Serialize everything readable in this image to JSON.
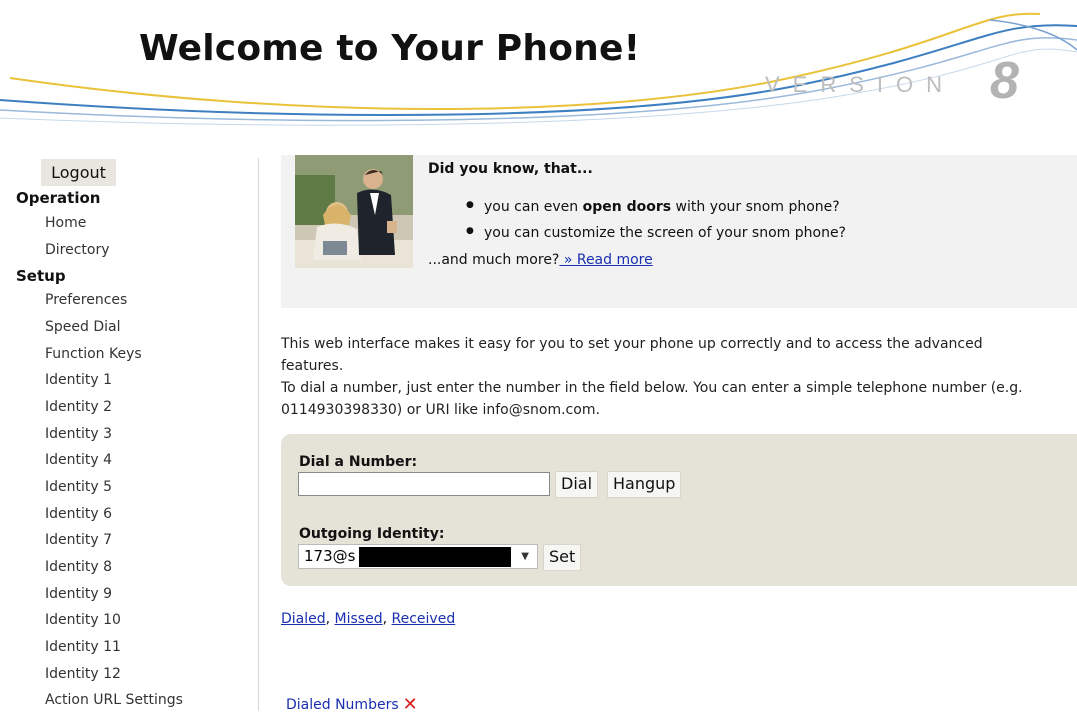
{
  "header": {
    "title": "Welcome to Your Phone!",
    "version_word": "VERSION",
    "version_number": "8"
  },
  "sidebar": {
    "logout_label": "Logout",
    "sections": [
      {
        "label": "Operation",
        "items": [
          "Home",
          "Directory"
        ]
      },
      {
        "label": "Setup",
        "items": [
          "Preferences",
          "Speed Dial",
          "Function Keys",
          "Identity 1",
          "Identity 2",
          "Identity 3",
          "Identity 4",
          "Identity 5",
          "Identity 6",
          "Identity 7",
          "Identity 8",
          "Identity 9",
          "Identity 10",
          "Identity 11",
          "Identity 12",
          "Action URL Settings"
        ]
      }
    ]
  },
  "did_you_know": {
    "title": "Did you know, that...",
    "bullet_1_pre": "you can even ",
    "bullet_1_bold": "open doors",
    "bullet_1_post": " with your snom phone?",
    "bullet_2": "you can customize the screen of your snom phone?",
    "more_text": "...and much more?",
    "read_more_label": " » Read more"
  },
  "intro": {
    "line_1": "This web interface makes it easy for you to set your phone up correctly and to access the advanced features.",
    "line_2": "To dial a number, just enter the number in the field below. You can enter a simple telephone number (e.g. 0114930398330) or URI like info@snom.com."
  },
  "dial": {
    "dial_label": "Dial a Number:",
    "number_value": "",
    "dial_button": "Dial",
    "hangup_button": "Hangup",
    "identity_label": "Outgoing Identity:",
    "identity_value": "173@s",
    "set_button": "Set"
  },
  "call_lists": {
    "dialed": "Dialed",
    "missed": "Missed",
    "received": "Received",
    "separator": ", ",
    "dialed_numbers_label": "Dialed Numbers"
  },
  "colors": {
    "link": "#1a2fb0",
    "dial_box_bg": "#e5e2d7",
    "did_you_know_bg": "#f2f2f2",
    "clear_icon": "#d81e1e"
  },
  "icons": {
    "clear": "close-icon",
    "dropdown": "chevron-down-icon"
  }
}
